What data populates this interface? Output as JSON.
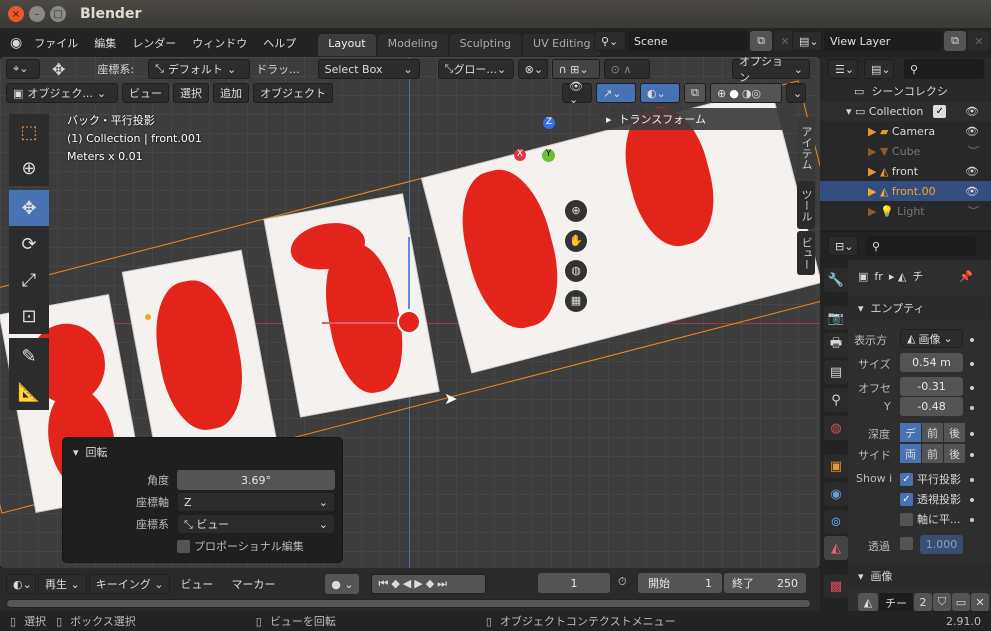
{
  "window": {
    "title": "Blender",
    "close": "×",
    "minimize": "–",
    "maximize": "□"
  },
  "menubar": {
    "items": [
      "ファイル",
      "編集",
      "レンダー",
      "ウィンドウ",
      "ヘルプ"
    ],
    "workspaces": [
      "Layout",
      "Modeling",
      "Sculpting",
      "UV Editing"
    ],
    "active_workspace": "Layout"
  },
  "scene": {
    "name": "Scene",
    "view_layer": "View Layer"
  },
  "tool_header": {
    "coord_label": "座標系:",
    "orientation": "デフォルト",
    "drag_label": "ドラッ...",
    "select_mode": "Select Box",
    "transform_orientation": "グロー...",
    "options": "オプション"
  },
  "view_header": {
    "mode": "オブジェク...",
    "menus": [
      "ビュー",
      "選択",
      "追加",
      "オブジェクト"
    ]
  },
  "viewport": {
    "projection": "バック・平行投影",
    "context": "(1) Collection | front.001",
    "units": "Meters x 0.01",
    "n_panel": "トランスフォーム",
    "side_tabs": [
      "アイテム",
      "ツール",
      "ビュー"
    ]
  },
  "operator": {
    "title": "回転",
    "angle_label": "角度",
    "angle": "3.69°",
    "axis_label": "座標軸",
    "axis": "Z",
    "orient_label": "座標系",
    "orient": "ビュー",
    "proportional": "プロポーショナル編集"
  },
  "timeline": {
    "menus": [
      "再生",
      "キーイング",
      "ビュー",
      "マーカー"
    ],
    "current_frame": "1",
    "start_label": "開始",
    "start": "1",
    "end_label": "終了",
    "end": "250"
  },
  "status": {
    "select": "選択",
    "box_select": "ボックス選択",
    "rotate_view": "ビューを回転",
    "context_menu": "オブジェクトコンテクストメニュー",
    "version": "2.91.0"
  },
  "outliner": {
    "root": "シーンコレクシ",
    "items": [
      {
        "name": "Collection",
        "color": "#cccccc"
      },
      {
        "name": "Camera",
        "color": "#cccccc"
      },
      {
        "name": "Cube",
        "color": "#777777"
      },
      {
        "name": "front",
        "color": "#cccccc"
      },
      {
        "name": "front.00",
        "color": "#f5a623"
      },
      {
        "name": "Light",
        "color": "#777777"
      }
    ]
  },
  "properties": {
    "breadcrumb_obj": "fr",
    "breadcrumb_data": "チ",
    "section": "エンプティ",
    "display_label": "表示方",
    "display": "画像",
    "size_label": "サイズ",
    "size": "0.54 m",
    "offset_label": "オフセ",
    "offset_x": "-0.31",
    "offset_y_label": "Y",
    "offset_y": "-0.48",
    "depth_label": "深度",
    "depth": [
      "デ",
      "前",
      "後"
    ],
    "side_label": "サイド",
    "side": [
      "両",
      "前",
      "後"
    ],
    "show_label": "Show i",
    "show_ortho": "平行投影",
    "show_persp": "透視投影",
    "show_axis": "軸に平...",
    "alpha_label": "透過",
    "alpha": "1.000",
    "image_section": "画像",
    "image_name": "チー",
    "image_users": "2"
  },
  "colors": {
    "accent": "#4772b3",
    "selected": "#f5a623"
  }
}
